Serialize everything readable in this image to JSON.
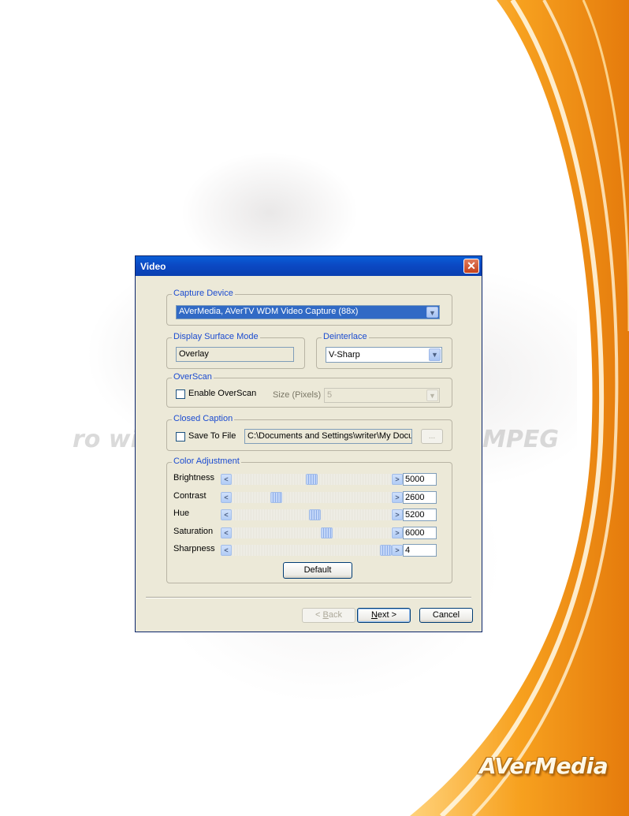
{
  "background": {
    "left_text": "ro with",
    "right_text": "MPEG",
    "brand_logo": "AVerMedia"
  },
  "dialog": {
    "title": "Video",
    "close_label": "✕",
    "capture_device": {
      "group_label": "Capture Device",
      "selected": "AVerMedia, AVerTV WDM Video Capture (88x)"
    },
    "display_surface_mode": {
      "group_label": "Display Surface Mode",
      "value": "Overlay"
    },
    "deinterlace": {
      "group_label": "Deinterlace",
      "selected": "V-Sharp"
    },
    "overscan": {
      "group_label": "OverScan",
      "checkbox_label": "Enable OverScan",
      "checked": false,
      "size_label": "Size (Pixels)",
      "size_value": "5"
    },
    "closed_caption": {
      "group_label": "Closed Caption",
      "checkbox_label": "Save To File",
      "checked": false,
      "path": "C:\\Documents and Settings\\writer\\My Docum",
      "browse_label": "..."
    },
    "color_adjustment": {
      "group_label": "Color Adjustment",
      "sliders": [
        {
          "label": "Brightness",
          "value": "5000",
          "fraction": 0.5
        },
        {
          "label": "Contrast",
          "value": "2600",
          "fraction": 0.26
        },
        {
          "label": "Hue",
          "value": "5200",
          "fraction": 0.52
        },
        {
          "label": "Saturation",
          "value": "6000",
          "fraction": 0.6
        },
        {
          "label": "Sharpness",
          "value": "4",
          "fraction": 1.0
        }
      ],
      "default_button": "Default"
    },
    "footer": {
      "back_prefix": "< ",
      "back_key": "B",
      "back_rest": "ack",
      "next_key": "N",
      "next_rest": "ext >",
      "cancel": "Cancel"
    }
  },
  "colors": {
    "title_bar": "#0b49c4",
    "group_label": "#1b4bd0",
    "selection": "#316ac5",
    "swoosh_orange": "#f39a1a"
  }
}
